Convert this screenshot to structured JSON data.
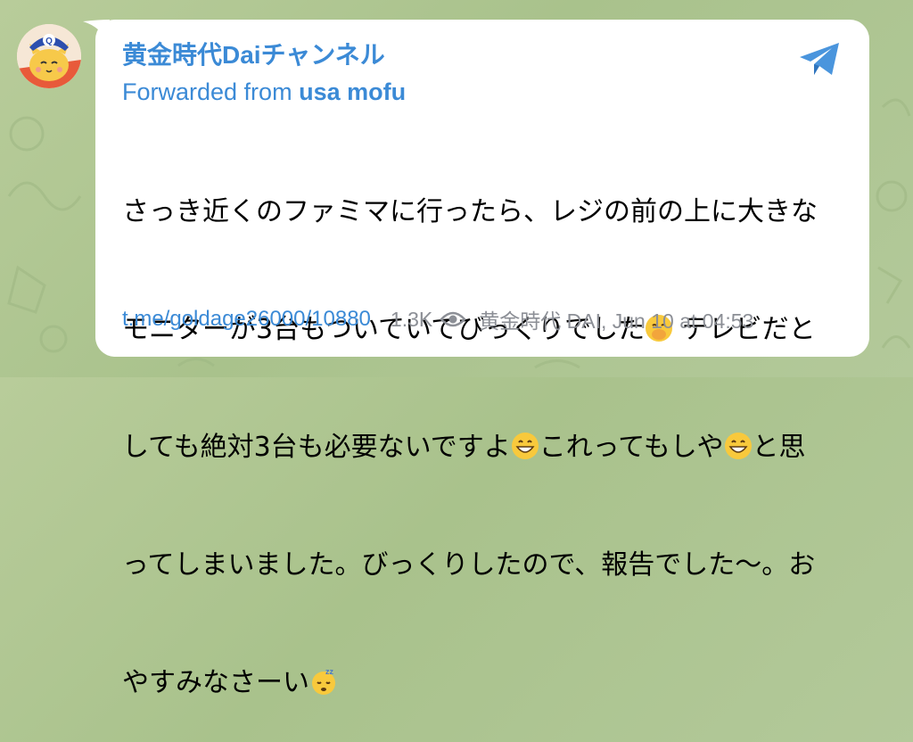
{
  "channel": {
    "name": "黄金時代Daiチャンネル",
    "forwarded_prefix": "Forwarded from",
    "forwarded_from": "usa mofu"
  },
  "message": {
    "lines": [
      "さっき近くのファミマに行ったら、レジの前の上に大きな",
      "モニターが3台もついていてびっくりでした",
      "テレビだと",
      "しても絶対3台も必要ないですよ",
      "これってもしや",
      "と思",
      "ってしまいました。びっくりしたので、報告でした〜。お",
      "やすみなさーい"
    ],
    "emojis": [
      "face-with-hand-over-mouth-icon",
      "grinning-icon",
      "grinning-icon",
      "sleeping-face-icon"
    ]
  },
  "footer": {
    "link": "t.me/goldage26000/10880",
    "views": "1.3K",
    "signature": "黄金時代 DAI, Jun 10 at 04:53"
  },
  "colors": {
    "accent": "#3b8ad6",
    "background": "#b3c99a",
    "bubble": "#ffffff",
    "meta": "#8c8f96"
  }
}
